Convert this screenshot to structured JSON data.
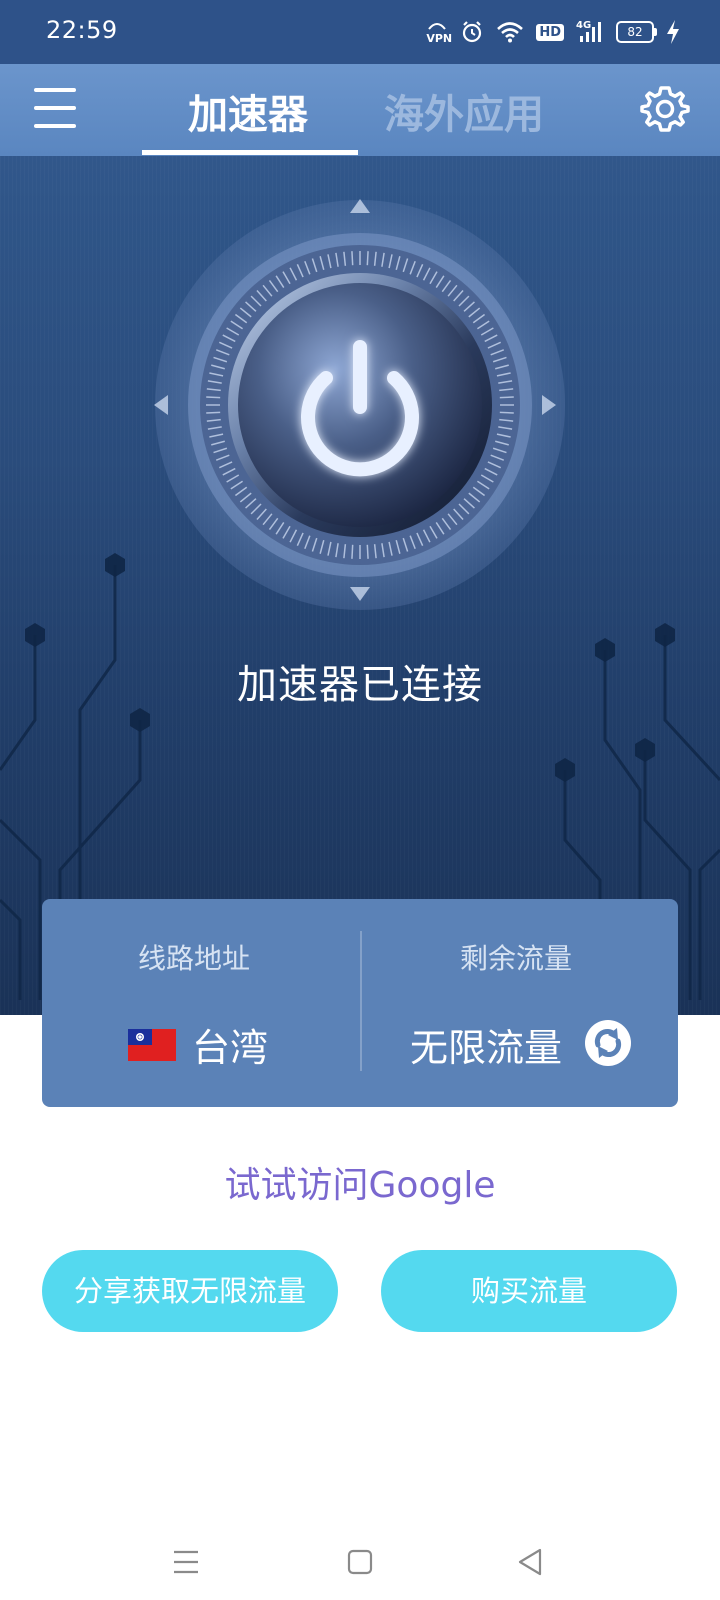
{
  "status_bar": {
    "time": "22:59",
    "vpn_label": "VPN",
    "hd_label": "HD",
    "network_label": "4G",
    "battery_level": "82",
    "icons": [
      "vpn-key-icon",
      "alarm-icon",
      "wifi-icon",
      "hd-icon",
      "signal-4g-icon",
      "battery-icon",
      "charging-bolt-icon"
    ]
  },
  "app_bar": {
    "menu_icon": "hamburger-menu-icon",
    "tabs": [
      {
        "label": "加速器",
        "active": true
      },
      {
        "label": "海外应用",
        "active": false
      }
    ],
    "settings_icon": "gear-icon"
  },
  "main": {
    "power_icon": "power-icon",
    "connection_status": "加速器已连接"
  },
  "info_card": {
    "route_label": "线路地址",
    "route_value": "台湾",
    "route_flag_icon": "taiwan-flag-icon",
    "remaining_label": "剩余流量",
    "remaining_value": "无限流量",
    "refresh_icon": "refresh-icon"
  },
  "google_link": "试试访问Google",
  "buttons": {
    "share": "分享获取无限流量",
    "buy": "购买流量"
  },
  "nav_bar": {
    "icons": [
      "recent-apps-icon",
      "home-icon",
      "back-icon"
    ]
  },
  "colors": {
    "status_bar_bg": "#2e5289",
    "app_bar_bg": "#5a86c0",
    "card_bg": "#5b82b7",
    "link_purple": "#7a68cf",
    "pill_cyan": "#54d9ef"
  }
}
